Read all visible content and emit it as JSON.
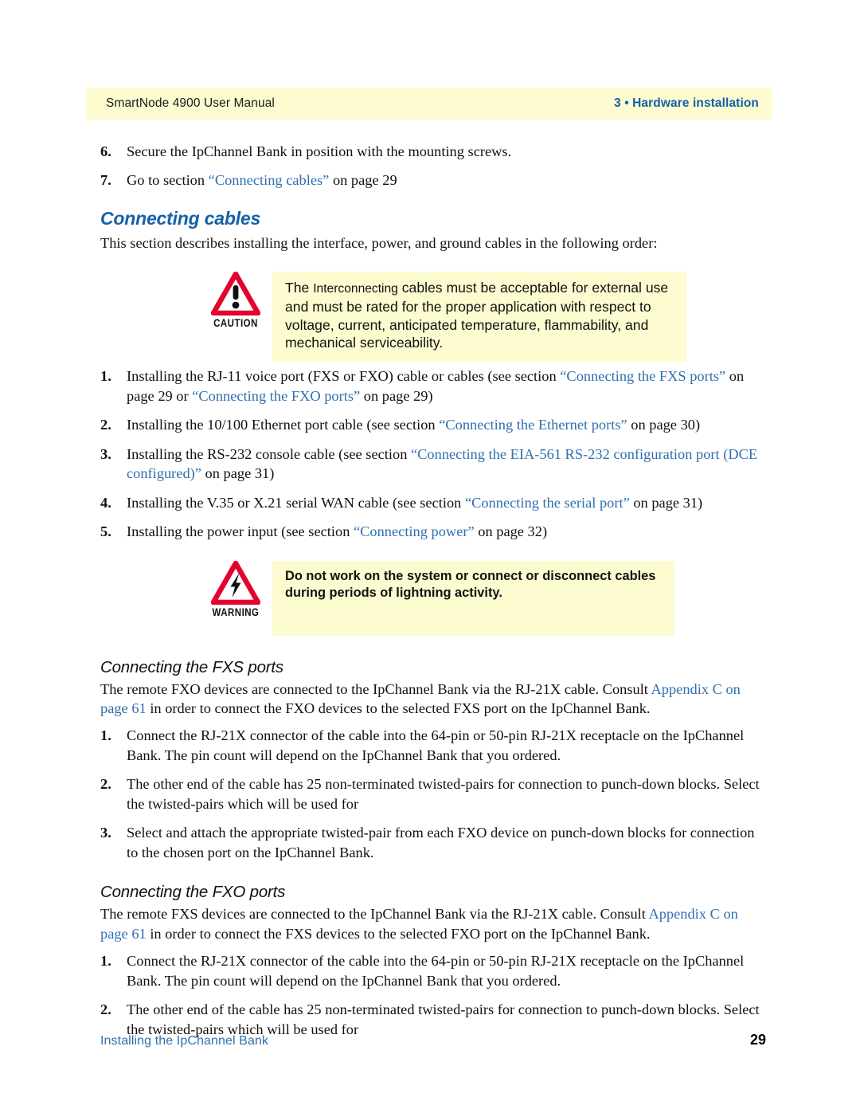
{
  "header": {
    "left": "SmartNode 4900 User Manual",
    "right": "3 • Hardware installation"
  },
  "colors": {
    "band_background": "#fdfbd0",
    "heading_blue": "#1560a8",
    "link_blue": "#2f6fae",
    "icon_red": "#e3032e",
    "body_text": "#111111"
  },
  "top_list": [
    {
      "num": "6.",
      "text": "Secure the IpChannel Bank in position with the mounting screws."
    },
    {
      "num": "7.",
      "pre": "Go to section ",
      "link": "“Connecting cables”",
      "post": " on page 29"
    }
  ],
  "section": {
    "title": "Connecting cables",
    "intro": "This section describes installing the interface, power, and ground cables in the following order:"
  },
  "caution": {
    "label": "CAUTION",
    "icon": "caution-triangle-icon",
    "text_lead": "The ",
    "text_small": "Interconnecting",
    "text_rest": " cables must be acceptable for external use and must be rated for the proper application with respect to voltage, current, anticipated temperature, flammability, and mechanical serviceability."
  },
  "warning": {
    "label": "WARNING",
    "icon": "warning-lightning-triangle-icon",
    "text": "Do not work on the system or connect or disconnect cables during periods of lightning activity."
  },
  "cable_steps": [
    {
      "num": "1.",
      "parts": [
        {
          "t": "Installing the RJ-11 voice port (FXS or FXO) cable or cables (see section ",
          "link": false
        },
        {
          "t": "“Connecting the FXS ports”",
          "link": true
        },
        {
          "t": " on page 29 or ",
          "link": false
        },
        {
          "t": "“Connecting the FXO ports”",
          "link": true
        },
        {
          "t": " on page 29)",
          "link": false
        }
      ]
    },
    {
      "num": "2.",
      "parts": [
        {
          "t": "Installing the 10/100 Ethernet port cable (see section ",
          "link": false
        },
        {
          "t": "“Connecting the Ethernet ports”",
          "link": true
        },
        {
          "t": " on page 30)",
          "link": false
        }
      ]
    },
    {
      "num": "3.",
      "parts": [
        {
          "t": "Installing the RS-232 console cable (see section ",
          "link": false
        },
        {
          "t": "“Connecting the EIA-561 RS-232 configuration port (DCE configured)”",
          "link": true
        },
        {
          "t": " on page 31)",
          "link": false
        }
      ]
    },
    {
      "num": "4.",
      "parts": [
        {
          "t": "Installing the V.35 or X.21 serial WAN cable (see section ",
          "link": false
        },
        {
          "t": "“Connecting the serial port”",
          "link": true
        },
        {
          "t": " on page 31)",
          "link": false
        }
      ]
    },
    {
      "num": "5.",
      "parts": [
        {
          "t": "Installing the power input (see section ",
          "link": false
        },
        {
          "t": "“Connecting power”",
          "link": true
        },
        {
          "t": " on page 32)",
          "link": false
        }
      ]
    }
  ],
  "fxs": {
    "heading": "Connecting the FXS ports",
    "intro_parts": [
      {
        "t": "The remote FXO devices are connected to the IpChannel Bank via the RJ-21X cable. Consult ",
        "link": false
      },
      {
        "t": "Appendix C on page 61",
        "link": true
      },
      {
        "t": " in order to connect the FXO devices to the selected FXS port on the IpChannel Bank.",
        "link": false
      }
    ],
    "steps": [
      {
        "num": "1.",
        "text": "Connect the RJ-21X connector of the cable into the 64-pin or 50-pin RJ-21X receptacle on the IpChannel Bank. The pin count will depend on the IpChannel Bank that you ordered."
      },
      {
        "num": "2.",
        "text": "The other end of the cable has 25 non-terminated twisted-pairs for connection to punch-down blocks. Select the twisted-pairs which will be used for"
      },
      {
        "num": "3.",
        "text": "Select and attach the appropriate twisted-pair from each FXO device on punch-down blocks for connection to the chosen port on the IpChannel Bank."
      }
    ]
  },
  "fxo": {
    "heading": "Connecting the FXO ports",
    "intro_parts": [
      {
        "t": "The remote FXS devices are connected to the IpChannel Bank via the RJ-21X cable. Consult ",
        "link": false
      },
      {
        "t": "Appendix C on page 61",
        "link": true
      },
      {
        "t": " in order to connect the FXS devices to the selected FXO port on the IpChannel Bank.",
        "link": false
      }
    ],
    "steps": [
      {
        "num": "1.",
        "text": "Connect the RJ-21X connector of the cable into the 64-pin or 50-pin RJ-21X receptacle on the IpChannel Bank. The pin count will depend on the IpChannel Bank that you ordered."
      },
      {
        "num": "2.",
        "text": "The other end of the cable has 25 non-terminated twisted-pairs for connection to punch-down blocks. Select the twisted-pairs which will be used for"
      }
    ]
  },
  "footer": {
    "left": "Installing the IpChannel Bank",
    "page": "29"
  }
}
